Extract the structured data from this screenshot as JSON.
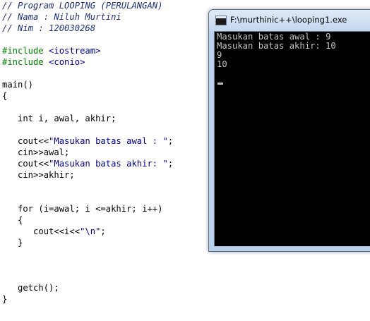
{
  "editor": {
    "lines": [
      [
        {
          "text": "// Program LOOPING (PERULANGAN)",
          "cls": "comment"
        }
      ],
      [
        {
          "text": "// Nama : Niluh Murtini",
          "cls": "comment"
        }
      ],
      [
        {
          "text": "// Nim : 120030268",
          "cls": "comment"
        }
      ],
      [],
      [
        {
          "text": "#include ",
          "cls": "preproc"
        },
        {
          "text": "<iostream>",
          "cls": "include-file"
        }
      ],
      [
        {
          "text": "#include ",
          "cls": "preproc"
        },
        {
          "text": "<conio>",
          "cls": "include-file"
        }
      ],
      [],
      [
        {
          "text": "main()",
          "cls": ""
        }
      ],
      [
        {
          "text": "{",
          "cls": ""
        }
      ],
      [],
      [
        {
          "text": "   int i, awal, akhir;",
          "cls": ""
        }
      ],
      [],
      [
        {
          "text": "   cout<<",
          "cls": ""
        },
        {
          "text": "\"Masukan batas awal : \"",
          "cls": "str"
        },
        {
          "text": ";",
          "cls": ""
        }
      ],
      [
        {
          "text": "   cin>>awal;",
          "cls": ""
        }
      ],
      [
        {
          "text": "   cout<<",
          "cls": ""
        },
        {
          "text": "\"Masukan batas akhir: \"",
          "cls": "str"
        },
        {
          "text": ";",
          "cls": ""
        }
      ],
      [
        {
          "text": "   cin>>akhir;",
          "cls": ""
        }
      ],
      [],
      [],
      [
        {
          "text": "   for (i=awal; i <=akhir; i++)",
          "cls": ""
        }
      ],
      [
        {
          "text": "   {",
          "cls": ""
        }
      ],
      [
        {
          "text": "      cout<<i<<",
          "cls": ""
        },
        {
          "text": "\"\\n\"",
          "cls": "str"
        },
        {
          "text": ";",
          "cls": ""
        }
      ],
      [
        {
          "text": "   }",
          "cls": ""
        }
      ],
      [],
      [],
      [],
      [
        {
          "text": "   getch();",
          "cls": ""
        }
      ],
      [
        {
          "text": "}",
          "cls": ""
        }
      ]
    ]
  },
  "console": {
    "title": "F:\\murthinic++\\looping1.exe",
    "lines": [
      "Masukan batas awal : 9",
      "Masukan batas akhir: 10",
      "9",
      "10"
    ]
  }
}
